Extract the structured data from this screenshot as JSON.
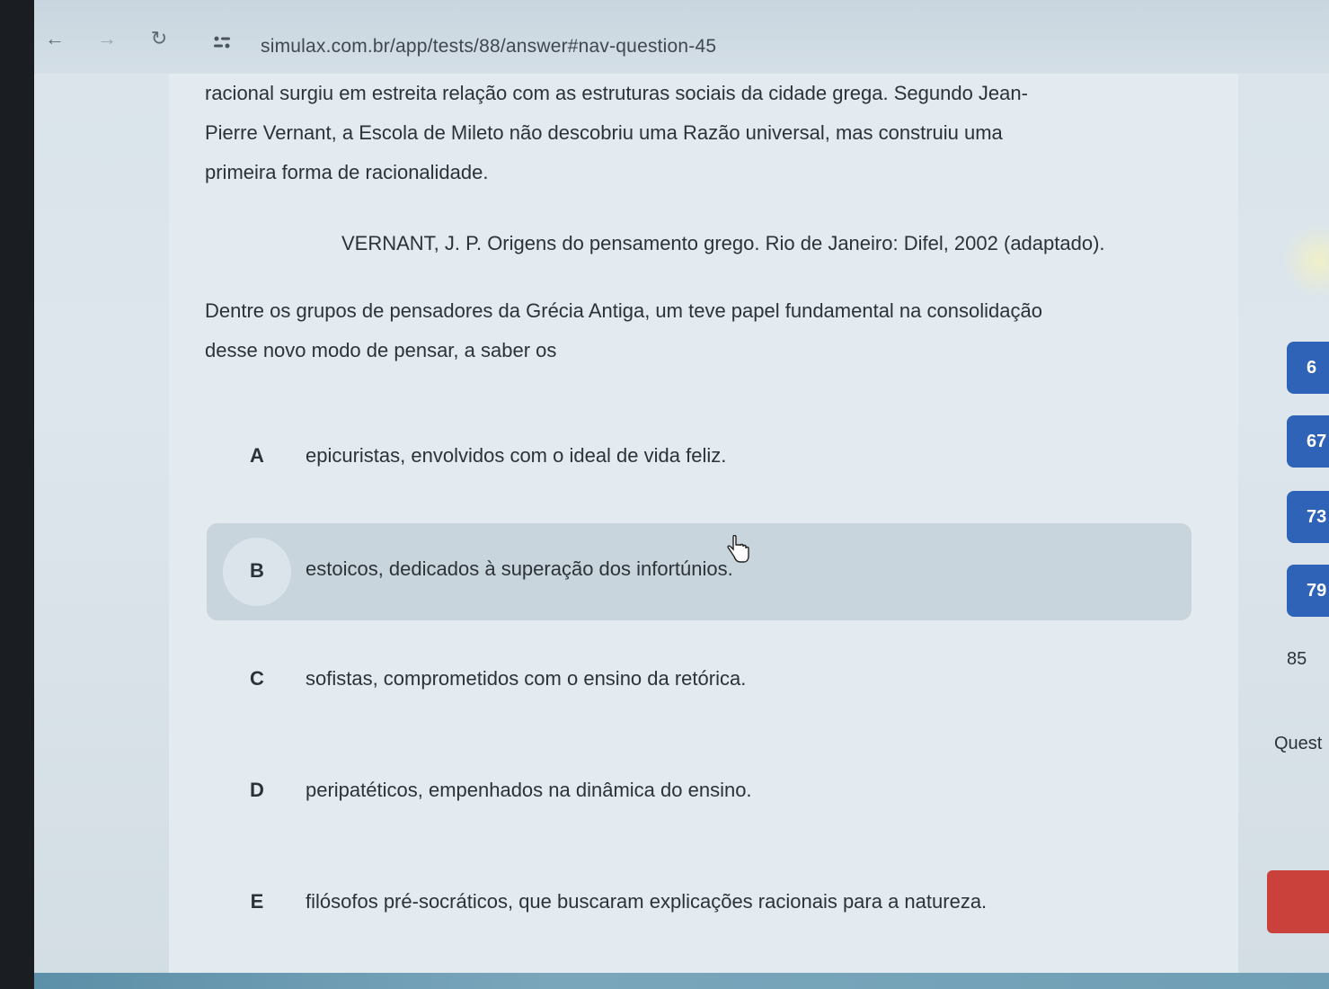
{
  "browser": {
    "url": "simulax.com.br/app/tests/88/answer#nav-question-45"
  },
  "question": {
    "text_lines": [
      "racional surgiu em estreita relação com as estruturas sociais da cidade grega. Segundo Jean-",
      "Pierre Vernant, a Escola de Mileto não descobriu uma Razão universal, mas construiu uma",
      "primeira forma de racionalidade."
    ],
    "citation": "VERNANT, J. P. Origens do pensamento grego. Rio de Janeiro: Difel, 2002 (adaptado).",
    "prompt_lines": [
      "Dentre os grupos de pensadores da Grécia Antiga, um teve papel fundamental na consolidação",
      "desse novo modo de pensar, a saber os"
    ]
  },
  "options": [
    {
      "letter": "A",
      "text": "epicuristas, envolvidos com o ideal de vida feliz."
    },
    {
      "letter": "B",
      "text": "estoicos, dedicados à superação dos infortúnios."
    },
    {
      "letter": "C",
      "text": "sofistas, comprometidos com o ensino da retórica."
    },
    {
      "letter": "D",
      "text": "peripatéticos, empenhados na dinâmica do ensino."
    },
    {
      "letter": "E",
      "text": "filósofos pré-socráticos, que buscaram explicações racionais para a natureza."
    }
  ],
  "hovered_option": "B",
  "side_nav": {
    "items": [
      "6",
      "67",
      "73",
      "79"
    ],
    "plain_number": "85",
    "section_label": "Quest"
  },
  "colors": {
    "nav_blue": "#2e63b8",
    "end_button_red": "#c9413a"
  }
}
